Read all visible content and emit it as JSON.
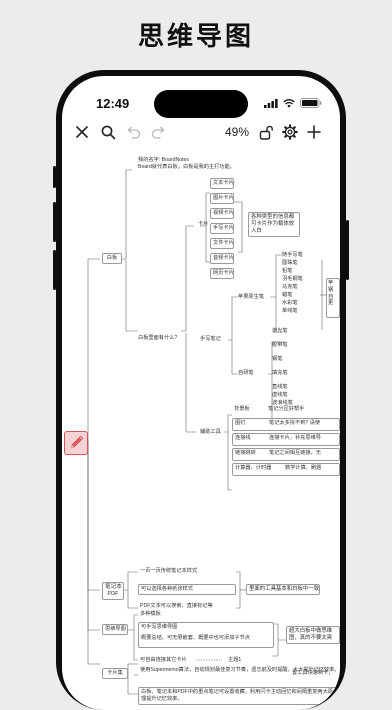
{
  "headline": "思维导图",
  "status": {
    "time": "12:49"
  },
  "toolbar": {
    "zoom": "49%"
  },
  "icons": [
    "close-icon",
    "search-icon",
    "undo-icon",
    "redo-icon",
    "lock-icon",
    "gear-icon",
    "plus-icon",
    "pencil-icon"
  ],
  "mindmap": {
    "intro": [
      "我的名字: BoardNotes",
      "Board就代表白板，白板是我的主打功能。"
    ],
    "b1": {
      "label": "白板"
    },
    "q1": "白板里面有什么?",
    "cards": {
      "label": "卡片",
      "items": [
        "文本卡片",
        "图片卡片",
        "视频卡片",
        "手写卡片",
        "文件卡片",
        "音频卡片",
        "网页卡片"
      ],
      "note": "各种类型的信息都可卡片作为载体放入白"
    },
    "handwriting": {
      "label": "手写笔记",
      "apple": {
        "label": "苹果原生笔",
        "items": [
          "随手写笔",
          "圆珠笔",
          "铅笔",
          "羽毛钢笔",
          "马克笔",
          "蜡笔",
          "水彩笔",
          "单线笔"
        ]
      },
      "custom": {
        "label": "自研笔",
        "items": [
          "激光笔",
          "胶带笔",
          "钢笔",
          "填充笔",
          "直线笔",
          "虚线笔",
          "波浪线笔"
        ]
      },
      "right": [
        "苹",
        "钢",
        "自",
        "更"
      ]
    },
    "tools": {
      "label": "辅助工具",
      "rows": [
        [
          "背景板",
          "笔记分区好帮手"
        ],
        [
          "图钉",
          "笔记太多找不到? 请使"
        ],
        [
          "连接线",
          "连接卡片，补充思维导"
        ],
        [
          "链接跳转",
          "笔记之间相互链接，无"
        ],
        [
          "计算器、计时器",
          "数学计算、刷题"
        ]
      ]
    },
    "b2": {
      "label1": "笔记本",
      "label2": "PDF",
      "items": [
        "一页一页传统笔记本样式",
        "可以选择各种纸张样式",
        "PDF文本可以搜索、直接标记等"
      ],
      "note": "里面的工具基本和白板中一致"
    },
    "b3": {
      "label": "思维导图",
      "items": [
        "多种模板",
        "可手写思维导图",
        "概要总结、可无限嵌套、概要中也可添加子节点",
        "可自由连接其它卡片"
      ],
      "end": "主题1",
      "note": "超大白板中做思维图，真的不要太爽"
    },
    "b4": {
      "label": "卡片集",
      "lines": [
        "使用Supermemo算法，自动规划最佳复习节奏，遗忘前及时提醒，大大提升记忆效率。",
        "白板、笔记本和PDF中的重点笔记可设置收藏，利用闪卡主动回忆和间隔重复两大原理提升记忆效率。",
        "置工具快速制卡，"
      ]
    }
  }
}
